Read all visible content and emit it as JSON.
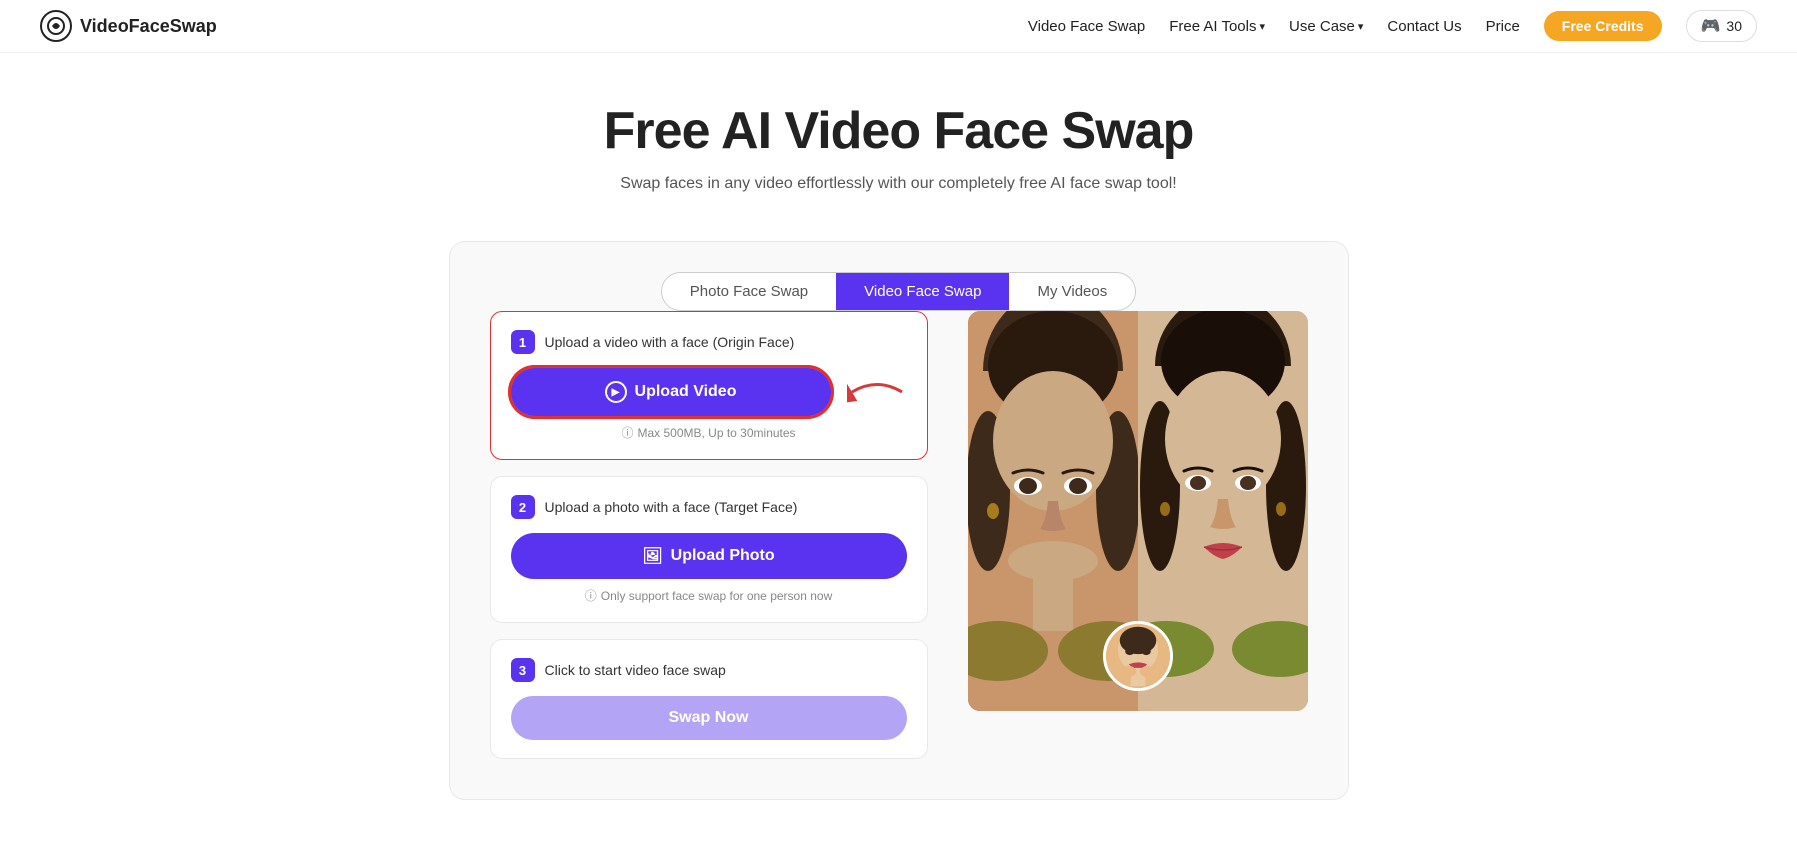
{
  "nav": {
    "logo_text": "VideoFaceSwap",
    "links": [
      {
        "label": "Video Face Swap",
        "dropdown": false
      },
      {
        "label": "Free AI Tools",
        "dropdown": true
      },
      {
        "label": "Use Case",
        "dropdown": true
      },
      {
        "label": "Contact Us",
        "dropdown": false
      },
      {
        "label": "Price",
        "dropdown": false
      }
    ],
    "free_credits_btn": "Free Credits",
    "credits_count": "30"
  },
  "hero": {
    "title": "Free AI Video Face Swap",
    "subtitle": "Swap faces in any video effortlessly with our completely free AI face swap tool!"
  },
  "tabs": [
    {
      "label": "Photo Face Swap",
      "active": false
    },
    {
      "label": "Video Face Swap",
      "active": true
    },
    {
      "label": "My Videos",
      "active": false
    }
  ],
  "steps": [
    {
      "num": "1",
      "title": "Upload a video with a face  (Origin Face)",
      "button_label": "Upload Video",
      "hint": "Max 500MB, Up to 30minutes",
      "highlight": true
    },
    {
      "num": "2",
      "title": "Upload a photo with a face  (Target Face)",
      "button_label": "Upload Photo",
      "hint": "Only support face swap for one person now",
      "highlight": false
    },
    {
      "num": "3",
      "title": "Click to start video face swap",
      "button_label": "Swap Now",
      "hint": "",
      "highlight": false
    }
  ]
}
